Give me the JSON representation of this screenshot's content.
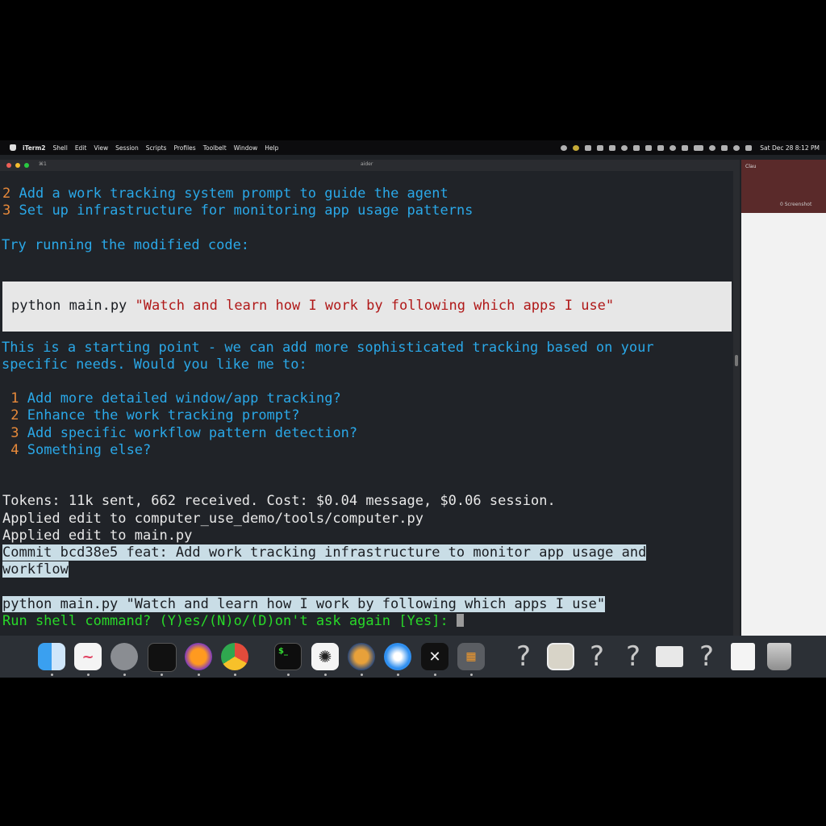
{
  "menubar": {
    "app": "iTerm2",
    "items": [
      "Shell",
      "Edit",
      "View",
      "Session",
      "Scripts",
      "Profiles",
      "Toolbelt",
      "Window",
      "Help"
    ],
    "clock": "Sat Dec 28 8:12 PM"
  },
  "terminal": {
    "tab_label": "⌘1",
    "title": "aider",
    "lines": {
      "l1_num": "2",
      "l1_text": "Add a work tracking system prompt to guide the agent",
      "l2_num": "3",
      "l2_text": "Set up infrastructure for monitoring app usage patterns",
      "try": "Try running the modified code:",
      "code_cmd": "python main.py ",
      "code_str": "\"Watch and learn how I work by following which apps I use\"",
      "p1": "This is a starting point - we can add more sophisticated tracking based on your",
      "p2": "specific needs. Would you like me to:",
      "o1_num": "1",
      "o1_text": "Add more detailed window/app tracking?",
      "o2_num": "2",
      "o2_text": "Enhance the work tracking prompt?",
      "o3_num": "3",
      "o3_text": "Add specific workflow pattern detection?",
      "o4_num": "4",
      "o4_text": "Something else?",
      "tokens": "Tokens: 11k sent, 662 received. Cost: $0.04 message, $0.06 session.",
      "applied1": "Applied edit to computer_use_demo/tools/computer.py",
      "applied2": "Applied edit to main.py",
      "commit1": "Commit bcd38e5 feat: Add work tracking infrastructure to monitor app usage and",
      "commit2": "workflow",
      "cmd": "python main.py \"Watch and learn how I work by following which apps I use\"",
      "prompt": "Run shell command? (Y)es/(N)o/(D)on't ask again [Yes]: "
    }
  },
  "right_window": {
    "tab_label": "Clau",
    "item": "0 Screenshot"
  },
  "dock": {
    "icons": [
      "finder-icon",
      "freeform-icon",
      "system-settings-icon",
      "activity-monitor-icon",
      "firefox-icon",
      "chrome-icon",
      "terminal-icon",
      "chatgpt-icon",
      "instruments-icon",
      "safari-icon",
      "xquartz-icon",
      "calculator-icon",
      "unknown-app-icon",
      "preview-icon",
      "unknown-app-icon",
      "unknown-app-icon",
      "window-icon",
      "unknown-app-icon",
      "document-icon",
      "trash-icon"
    ],
    "question_glyph": "?",
    "terminal_glyph": "$_"
  },
  "colors": {
    "cyan": "#2aa8e8",
    "orange": "#e88a3a",
    "green": "#28d828",
    "highlight": "#c9dde6",
    "string_red": "#b01818"
  }
}
